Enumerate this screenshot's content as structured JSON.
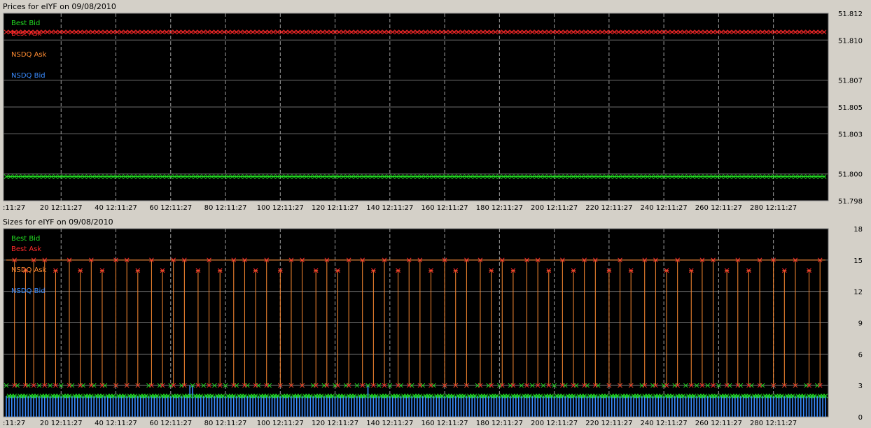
{
  "charts": {
    "prices": {
      "title": "Prices for  eIYF  on  09/08/2010"
    },
    "sizes": {
      "title": "Sizes for  eIYF  on  09/08/2010"
    }
  },
  "colors": {
    "best_bid": "#22dd22",
    "best_ask": "#ff2a2a",
    "nsdq_ask": "#ff8c32",
    "nsdq_bid": "#3a8cff",
    "grid": "#6e6e6e",
    "plot_bg": "#000000"
  },
  "chart_data": [
    {
      "type": "line",
      "title": "Prices for  eIYF  on  09/08/2010",
      "xlim": [
        0,
        299
      ],
      "ylim": [
        51.798,
        51.812
      ],
      "x_tick_values": [
        0,
        20,
        40,
        60,
        80,
        100,
        120,
        140,
        160,
        180,
        200,
        220,
        240,
        260,
        280
      ],
      "x_tick_labels": [
        ":11:27",
        "20 12:11:27",
        "40 12:11:27",
        "60 12:11:27",
        "80 12:11:27",
        "100 12:11:27",
        "120 12:11:27",
        "140 12:11:27",
        "160 12:11:27",
        "180 12:11:27",
        "200 12:11:27",
        "220 12:11:27",
        "240 12:11:27",
        "260 12:11:27",
        "280 12:11:27"
      ],
      "y_tick_values": [
        51.812,
        51.81,
        51.807,
        51.805,
        51.803,
        51.8,
        51.798
      ],
      "y_tick_labels": [
        "51.812",
        "51.810",
        "51.807",
        "51.805",
        "51.803",
        "51.800",
        "51.798"
      ],
      "grid": true,
      "legend_position": "top-left",
      "series": [
        {
          "name": "Best Bid",
          "constant": 51.7998
        },
        {
          "name": "Best Ask",
          "constant": 51.8106
        },
        {
          "name": "NSDQ Ask",
          "constant": null
        },
        {
          "name": "NSDQ Bid",
          "constant": null
        }
      ]
    },
    {
      "type": "bar",
      "title": "Sizes for  eIYF  on  09/08/2010",
      "xlim": [
        0,
        299
      ],
      "ylim": [
        0,
        18
      ],
      "x_tick_values": [
        0,
        20,
        40,
        60,
        80,
        100,
        120,
        140,
        160,
        180,
        200,
        220,
        240,
        260,
        280
      ],
      "x_tick_labels": [
        ":11:27",
        "20 12:11:27",
        "40 12:11:27",
        "60 12:11:27",
        "80 12:11:27",
        "100 12:11:27",
        "120 12:11:27",
        "140 12:11:27",
        "160 12:11:27",
        "180 12:11:27",
        "200 12:11:27",
        "220 12:11:27",
        "240 12:11:27",
        "260 12:11:27",
        "280 12:11:27"
      ],
      "y_tick_values": [
        18,
        15,
        12,
        9,
        6,
        3,
        0
      ],
      "y_tick_labels": [
        "18",
        "15",
        "12",
        "9",
        "6",
        "3",
        "0"
      ],
      "grid": true,
      "legend_position": "top-left",
      "series": [
        {
          "name": "Best Bid",
          "values_summary": "alternating 2 and 3"
        },
        {
          "name": "Best Ask",
          "values_summary": "mostly 3, spikes to 15 or 14"
        },
        {
          "name": "NSDQ Ask",
          "values_summary": "spikes to 15 and 14"
        },
        {
          "name": "NSDQ Bid",
          "values_summary": "mostly 2"
        }
      ],
      "spike_x": [
        3,
        7,
        10,
        14,
        18,
        23,
        27,
        31,
        35,
        40,
        44,
        48,
        53,
        57,
        61,
        65,
        70,
        74,
        78,
        83,
        87,
        91,
        95,
        100,
        104,
        108,
        113,
        117,
        121,
        125,
        130,
        134,
        138,
        143,
        147,
        151,
        155,
        160,
        164,
        168,
        173,
        177,
        181,
        185,
        190,
        194,
        198,
        203,
        207,
        211,
        215,
        220,
        224,
        228,
        233,
        237,
        241,
        245,
        250,
        254,
        258,
        263,
        267,
        271,
        275,
        280,
        284,
        288,
        293,
        297
      ],
      "spike_y": [
        15,
        14,
        15,
        15,
        14,
        15,
        14,
        15,
        14,
        15,
        15,
        14,
        15,
        14,
        15,
        15,
        14,
        15,
        14,
        15,
        15,
        14,
        15,
        14,
        15,
        15,
        14,
        15,
        14,
        15,
        15,
        14,
        15,
        14,
        15,
        15,
        14,
        15,
        14,
        15,
        15,
        14,
        15,
        14,
        15,
        15,
        14,
        15,
        14,
        15,
        15,
        14,
        15,
        14,
        15,
        15,
        14,
        15,
        14,
        15,
        15,
        14,
        15,
        14,
        15,
        15,
        14,
        15,
        14,
        15
      ]
    }
  ]
}
